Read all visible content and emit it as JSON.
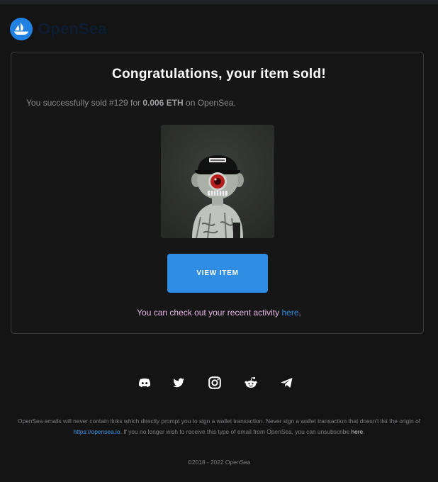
{
  "brand": {
    "name": "OpenSea",
    "color": "#2081e2"
  },
  "card": {
    "title": "Congratulations, your item sold!",
    "message_prefix": "You successfully sold #129 for ",
    "price": "0.006 ETH",
    "message_suffix": " on OpenSea.",
    "nft_image": {
      "label": "NFT artwork #129",
      "icon": "nft-image"
    },
    "view_button": "VIEW ITEM",
    "activity_prefix": "You can check out your recent activity ",
    "activity_link": "here",
    "activity_suffix": "."
  },
  "social": [
    {
      "name": "discord",
      "icon": "discord-icon"
    },
    {
      "name": "twitter",
      "icon": "twitter-icon"
    },
    {
      "name": "instagram",
      "icon": "instagram-icon"
    },
    {
      "name": "reddit",
      "icon": "reddit-icon"
    },
    {
      "name": "telegram",
      "icon": "telegram-icon"
    }
  ],
  "footer": {
    "disclaimer_part1": "OpenSea emails will never contain links which directly prompt you to sign a wallet transaction. Never sign a wallet transaction that doesn't list the origin of ",
    "origin_link": "https://opensea.io",
    "disclaimer_part2": ". If you no longer wish to receive this type of email from OpenSea, you can unsubscribe ",
    "unsubscribe_link": "here",
    "disclaimer_part3": ".",
    "copyright": "©2018 - 2022 OpenSea"
  },
  "colors": {
    "background": "#141415",
    "card_border": "#3a3a3c",
    "button": "#2f8de4",
    "activity_text": "#e7b7e4",
    "link": "#2f8de4"
  }
}
